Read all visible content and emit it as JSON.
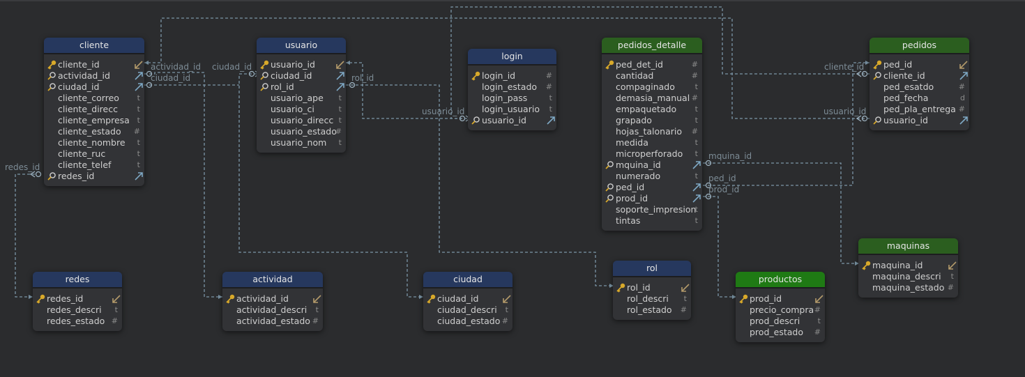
{
  "entities": [
    {
      "id": "cliente",
      "title": "cliente",
      "header": "blue",
      "fields": [
        {
          "name": "cliente_id",
          "icon": "key",
          "mark": "ref-in"
        },
        {
          "name": "actividad_id",
          "icon": "fk",
          "mark": "fk-out"
        },
        {
          "name": "ciudad_id",
          "icon": "fk",
          "mark": "fk-out"
        },
        {
          "name": "cliente_correo",
          "type": "t"
        },
        {
          "name": "cliente_direcc",
          "type": "t"
        },
        {
          "name": "cliente_empresa",
          "type": "t"
        },
        {
          "name": "cliente_estado",
          "type": "#"
        },
        {
          "name": "cliente_nombre",
          "type": "t"
        },
        {
          "name": "cliente_ruc",
          "type": "t"
        },
        {
          "name": "cliente_telef",
          "type": "t"
        },
        {
          "name": "redes_id",
          "icon": "fk",
          "mark": "fk-out"
        }
      ]
    },
    {
      "id": "usuario",
      "title": "usuario",
      "header": "blue",
      "fields": [
        {
          "name": "usuario_id",
          "icon": "key",
          "mark": "ref-in"
        },
        {
          "name": "ciudad_id",
          "icon": "fk",
          "mark": "fk-out"
        },
        {
          "name": "rol_id",
          "icon": "fk",
          "mark": "fk-out"
        },
        {
          "name": "usuario_ape",
          "type": "t"
        },
        {
          "name": "usuario_ci",
          "type": "t"
        },
        {
          "name": "usuario_direcc",
          "type": "t"
        },
        {
          "name": "usuario_estado",
          "type": "#"
        },
        {
          "name": "usuario_nom",
          "type": "t"
        }
      ]
    },
    {
      "id": "login",
      "title": "login",
      "header": "blue",
      "fields": [
        {
          "name": "login_id",
          "icon": "key",
          "type": "#"
        },
        {
          "name": "login_estado",
          "type": "#"
        },
        {
          "name": "login_pass",
          "type": "t"
        },
        {
          "name": "login_usuario",
          "type": "t"
        },
        {
          "name": "usuario_id",
          "icon": "fk",
          "mark": "fk-out"
        }
      ]
    },
    {
      "id": "pedidos_detalle",
      "title": "pedidos_detalle",
      "header": "green",
      "fields": [
        {
          "name": "ped_det_id",
          "icon": "key",
          "type": "#"
        },
        {
          "name": "cantidad",
          "type": "#"
        },
        {
          "name": "compaginado",
          "type": "t"
        },
        {
          "name": "demasia_manual",
          "type": "#"
        },
        {
          "name": "empaquetado",
          "type": "t"
        },
        {
          "name": "grapado",
          "type": "t"
        },
        {
          "name": "hojas_talonario",
          "type": "#"
        },
        {
          "name": "medida",
          "type": "t"
        },
        {
          "name": "microperforado",
          "type": "t"
        },
        {
          "name": "mquina_id",
          "icon": "fk",
          "mark": "fk-out"
        },
        {
          "name": "numerado",
          "type": "t"
        },
        {
          "name": "ped_id",
          "icon": "fk",
          "mark": "fk-out"
        },
        {
          "name": "prod_id",
          "icon": "fk",
          "mark": "fk-out"
        },
        {
          "name": "soporte_impresion",
          "type": "t"
        },
        {
          "name": "tintas",
          "type": "t"
        }
      ]
    },
    {
      "id": "pedidos",
      "title": "pedidos",
      "header": "green",
      "fields": [
        {
          "name": "ped_id",
          "icon": "key",
          "mark": "ref-in"
        },
        {
          "name": "cliente_id",
          "icon": "fk",
          "mark": "fk-out"
        },
        {
          "name": "ped_esatdo",
          "type": "#"
        },
        {
          "name": "ped_fecha",
          "type": "d"
        },
        {
          "name": "ped_pla_entrega",
          "type": "#"
        },
        {
          "name": "usuario_id",
          "icon": "fk",
          "mark": "fk-out"
        }
      ]
    },
    {
      "id": "redes",
      "title": "redes",
      "header": "blue",
      "fields": [
        {
          "name": "redes_id",
          "icon": "key",
          "mark": "ref-in"
        },
        {
          "name": "redes_descri",
          "type": "t"
        },
        {
          "name": "redes_estado",
          "type": "#"
        }
      ]
    },
    {
      "id": "actividad",
      "title": "actividad",
      "header": "blue",
      "fields": [
        {
          "name": "actividad_id",
          "icon": "key",
          "mark": "ref-in"
        },
        {
          "name": "actividad_descri",
          "type": "t"
        },
        {
          "name": "actividad_estado",
          "type": "#"
        }
      ]
    },
    {
      "id": "ciudad",
      "title": "ciudad",
      "header": "blue",
      "fields": [
        {
          "name": "ciudad_id",
          "icon": "key",
          "mark": "ref-in"
        },
        {
          "name": "ciudad_descri",
          "type": "t"
        },
        {
          "name": "ciudad_estado",
          "type": "#"
        }
      ]
    },
    {
      "id": "rol",
      "title": "rol",
      "header": "blue",
      "fields": [
        {
          "name": "rol_id",
          "icon": "key",
          "mark": "ref-in"
        },
        {
          "name": "rol_descri",
          "type": "t"
        },
        {
          "name": "rol_estado",
          "type": "#"
        }
      ]
    },
    {
      "id": "productos",
      "title": "productos",
      "header": "green-bright",
      "fields": [
        {
          "name": "prod_id",
          "icon": "key",
          "mark": "ref-in"
        },
        {
          "name": "precio_compra",
          "type": "#"
        },
        {
          "name": "prod_descri",
          "type": "t"
        },
        {
          "name": "prod_estado",
          "type": "#"
        }
      ]
    },
    {
      "id": "maquinas",
      "title": "maquinas",
      "header": "green",
      "fields": [
        {
          "name": "maquina_id",
          "icon": "key",
          "mark": "ref-in"
        },
        {
          "name": "maquina_descri",
          "type": "t"
        },
        {
          "name": "maquina_estado",
          "type": "#"
        }
      ]
    }
  ],
  "relation_labels": {
    "cliente_actividad": "actividad_id",
    "cliente_ciudad": "ciudad_id",
    "cliente_redes": "redes_id",
    "usuario_ciudad": "ciudad_id",
    "usuario_rol": "rol_id",
    "login_usuario": "usuario_id",
    "pedidos_cliente": "cliente_id",
    "pedidos_usuario": "usuario_id",
    "detalle_maquina": "mquina_id",
    "detalle_ped": "ped_id",
    "detalle_prod": "prod_id"
  },
  "colors": {
    "background": "#2b2c2e",
    "line": "#7b95a6",
    "header_blue": "#26385e",
    "header_green": "#2b5e1f",
    "key": "#d8a92a",
    "fk_arrow": "#7ea8c4",
    "ref_arrow": "#b39a6a"
  }
}
